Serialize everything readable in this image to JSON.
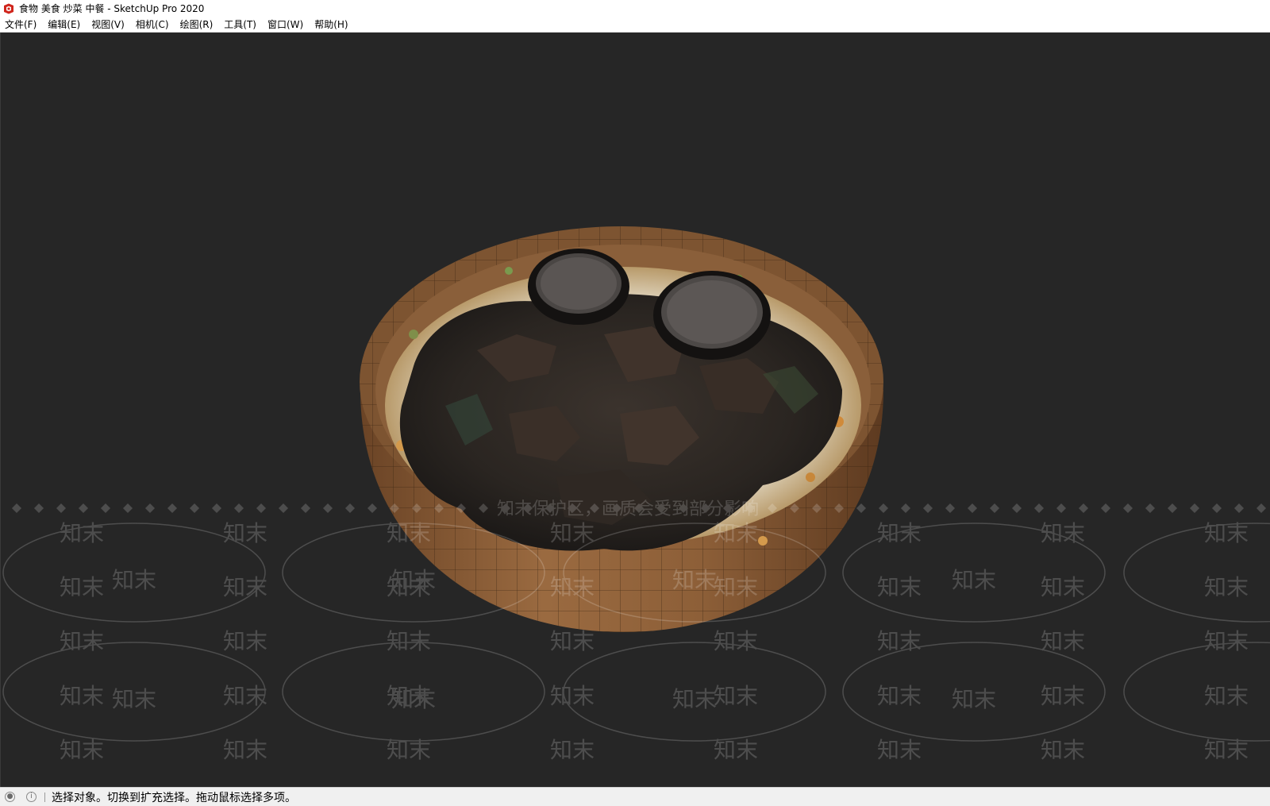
{
  "window": {
    "title": "食物 美食 炒菜 中餐 - SketchUp Pro 2020"
  },
  "menu": {
    "items": [
      "文件(F)",
      "编辑(E)",
      "视图(V)",
      "相机(C)",
      "绘图(R)",
      "工具(T)",
      "窗口(W)",
      "帮助(H)"
    ]
  },
  "viewport": {
    "background_color": "#262626",
    "model": "bowl-of-stir-fried-meat"
  },
  "watermark": {
    "brand": "知末",
    "notice": "知末保护区，画质会受到部分影响"
  },
  "statusbar": {
    "icons": [
      "geo-location-icon",
      "info-icon"
    ],
    "message": "选择对象。切换到扩充选择。拖动鼠标选择多项。"
  },
  "colors": {
    "sketchup_red": "#d0251c",
    "bowl_wood": "#8a5a34",
    "food_dark": "#2a2622"
  }
}
